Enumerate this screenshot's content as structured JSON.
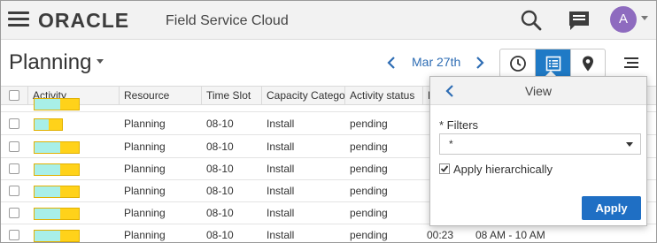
{
  "header": {
    "brand": "ORACLE",
    "app_title": "Field Service Cloud",
    "avatar_initial": "A",
    "avatar_color": "#8e6bbf"
  },
  "toolbar": {
    "page_title": "Planning",
    "date": "Mar 27th",
    "view_modes": [
      "clock-icon",
      "list-icon",
      "map-pin-icon"
    ],
    "active_view": "list-icon",
    "accent_color": "#1f7ac6"
  },
  "table": {
    "columns": [
      "Activity",
      "Resource",
      "Time Slot",
      "Capacity Catego",
      "Activity status",
      "E"
    ],
    "rows": [
      {
        "resource": "Planning",
        "time_slot": "08-10",
        "capacity": "Install",
        "status": "pending",
        "extra": "",
        "window": ""
      },
      {
        "resource": "Planning",
        "time_slot": "08-10",
        "capacity": "Install",
        "status": "pending",
        "extra": "",
        "window": ""
      },
      {
        "resource": "Planning",
        "time_slot": "08-10",
        "capacity": "Install",
        "status": "pending",
        "extra": "",
        "window": ""
      },
      {
        "resource": "Planning",
        "time_slot": "08-10",
        "capacity": "Install",
        "status": "pending",
        "extra": "",
        "window": ""
      },
      {
        "resource": "Planning",
        "time_slot": "08-10",
        "capacity": "Install",
        "status": "pending",
        "extra": "",
        "window": ""
      },
      {
        "resource": "Planning",
        "time_slot": "08-10",
        "capacity": "Install",
        "status": "pending",
        "extra": "00:23",
        "window": "08 AM - 10 AM"
      }
    ]
  },
  "view_panel": {
    "title": "View",
    "filters_label": "* Filters",
    "filters_value": "*",
    "apply_hierarchically_label": "Apply hierarchically",
    "apply_hierarchically_checked": true,
    "apply_button": "Apply"
  }
}
